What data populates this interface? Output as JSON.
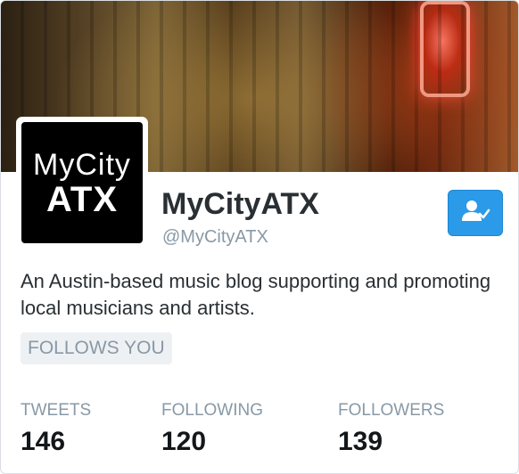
{
  "profile": {
    "avatar_line1": "MyCity",
    "avatar_line2": "ATX",
    "name": "MyCityATX",
    "handle": "@MyCityATX",
    "bio": "An Austin-based music blog supporting and promoting local musicians and artists.",
    "follows_badge": "FOLLOWS YOU"
  },
  "follow_button": {
    "icon": "user-check-icon",
    "color": "#2b9ae8"
  },
  "stats": [
    {
      "label": "TWEETS",
      "value": "146"
    },
    {
      "label": "FOLLOWING",
      "value": "120"
    },
    {
      "label": "FOLLOWERS",
      "value": "139"
    }
  ],
  "colors": {
    "text": "#292f33",
    "muted": "#8899a6",
    "accent": "#2b9ae8"
  }
}
